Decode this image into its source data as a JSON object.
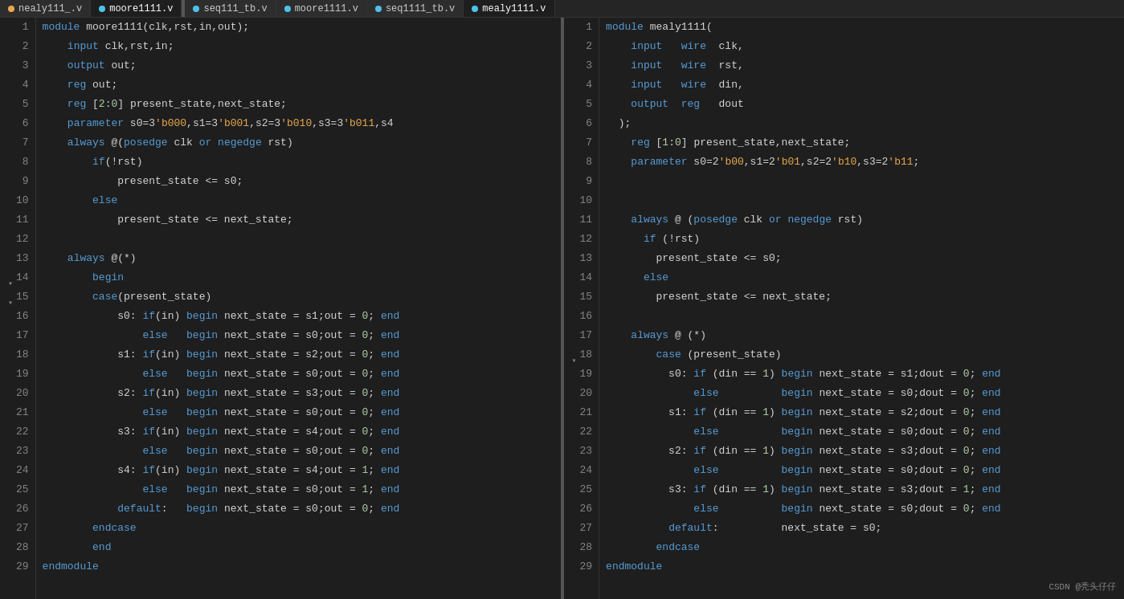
{
  "left_tabs": [
    {
      "label": "nealy111_.v",
      "icon": "orange",
      "active": false
    },
    {
      "label": "moore1111.v",
      "icon": "blue",
      "active": true
    }
  ],
  "right_tabs": [
    {
      "label": "seq111_tb.v",
      "icon": "blue",
      "active": false
    },
    {
      "label": "moore1111.v",
      "icon": "blue",
      "active": false
    },
    {
      "label": "seq1111_tb.v",
      "icon": "blue",
      "active": false
    },
    {
      "label": "mealy1111.v",
      "icon": "blue",
      "active": true
    }
  ],
  "watermark": "CSDN @秃头仔仔",
  "left_code": [
    {
      "n": 1,
      "text": "module moore1111(clk,rst,in,out);"
    },
    {
      "n": 2,
      "text": "    input clk,rst,in;"
    },
    {
      "n": 3,
      "text": "    output out;"
    },
    {
      "n": 4,
      "text": "    reg out;"
    },
    {
      "n": 5,
      "text": "    reg [2:0] present_state,next_state;"
    },
    {
      "n": 6,
      "text": "    parameter s0=3'b000,s1=3'b001,s2=3'b010,s3=3'b011,s4"
    },
    {
      "n": 7,
      "text": "    always @(posedge clk or negedge rst)"
    },
    {
      "n": 8,
      "text": "        if(!rst)"
    },
    {
      "n": 9,
      "text": "            present_state <= s0;"
    },
    {
      "n": 10,
      "text": "        else"
    },
    {
      "n": 11,
      "text": "            present_state <= next_state;"
    },
    {
      "n": 12,
      "text": ""
    },
    {
      "n": 13,
      "text": "    always @(*)"
    },
    {
      "n": 14,
      "text": "        begin"
    },
    {
      "n": 15,
      "text": "        case(present_state)"
    },
    {
      "n": 16,
      "text": "            s0: if(in) begin next_state = s1;out = 0; end"
    },
    {
      "n": 17,
      "text": "                else   begin next_state = s0;out = 0; end"
    },
    {
      "n": 18,
      "text": "            s1: if(in) begin next_state = s2;out = 0; end"
    },
    {
      "n": 19,
      "text": "                else   begin next_state = s0;out = 0; end"
    },
    {
      "n": 20,
      "text": "            s2: if(in) begin next_state = s3;out = 0; end"
    },
    {
      "n": 21,
      "text": "                else   begin next_state = s0;out = 0; end"
    },
    {
      "n": 22,
      "text": "            s3: if(in) begin next_state = s4;out = 0; end"
    },
    {
      "n": 23,
      "text": "                else   begin next_state = s0;out = 0; end"
    },
    {
      "n": 24,
      "text": "            s4: if(in) begin next_state = s4;out = 1; end"
    },
    {
      "n": 25,
      "text": "                else   begin next_state = s0;out = 1; end"
    },
    {
      "n": 26,
      "text": "            default:   begin next_state = s0;out = 0; end"
    },
    {
      "n": 27,
      "text": "        endcase"
    },
    {
      "n": 28,
      "text": "        end"
    },
    {
      "n": 29,
      "text": "endmodule"
    }
  ],
  "right_code": [
    {
      "n": 1,
      "text": "module mealy1111("
    },
    {
      "n": 2,
      "text": "    input   wire  clk,"
    },
    {
      "n": 3,
      "text": "    input   wire  rst,"
    },
    {
      "n": 4,
      "text": "    input   wire  din,"
    },
    {
      "n": 5,
      "text": "    output  reg   dout"
    },
    {
      "n": 6,
      "text": "  );"
    },
    {
      "n": 7,
      "text": "    reg [1:0] present_state,next_state;"
    },
    {
      "n": 8,
      "text": "    parameter s0=2'b00,s1=2'b01,s2=2'b10,s3=2'b11;"
    },
    {
      "n": 9,
      "text": ""
    },
    {
      "n": 10,
      "text": ""
    },
    {
      "n": 11,
      "text": "    always @ (posedge clk or negedge rst)"
    },
    {
      "n": 12,
      "text": "      if (!rst)"
    },
    {
      "n": 13,
      "text": "        present_state <= s0;"
    },
    {
      "n": 14,
      "text": "      else"
    },
    {
      "n": 15,
      "text": "        present_state <= next_state;"
    },
    {
      "n": 16,
      "text": ""
    },
    {
      "n": 17,
      "text": "    always @ (*)"
    },
    {
      "n": 18,
      "text": "        case (present_state)"
    },
    {
      "n": 19,
      "text": "          s0: if (din == 1) begin next_state = s1;dout = 0; end"
    },
    {
      "n": 20,
      "text": "              else          begin next_state = s0;dout = 0; end"
    },
    {
      "n": 21,
      "text": "          s1: if (din == 1) begin next_state = s2;dout = 0; end"
    },
    {
      "n": 22,
      "text": "              else          begin next_state = s0;dout = 0; end"
    },
    {
      "n": 23,
      "text": "          s2: if (din == 1) begin next_state = s3;dout = 0; end"
    },
    {
      "n": 24,
      "text": "              else          begin next_state = s0;dout = 0; end"
    },
    {
      "n": 25,
      "text": "          s3: if (din == 1) begin next_state = s3;dout = 1; end"
    },
    {
      "n": 26,
      "text": "              else          begin next_state = s0;dout = 0; end"
    },
    {
      "n": 27,
      "text": "          default:          next_state = s0;"
    },
    {
      "n": 28,
      "text": "        endcase"
    },
    {
      "n": 29,
      "text": "endmodule"
    }
  ]
}
